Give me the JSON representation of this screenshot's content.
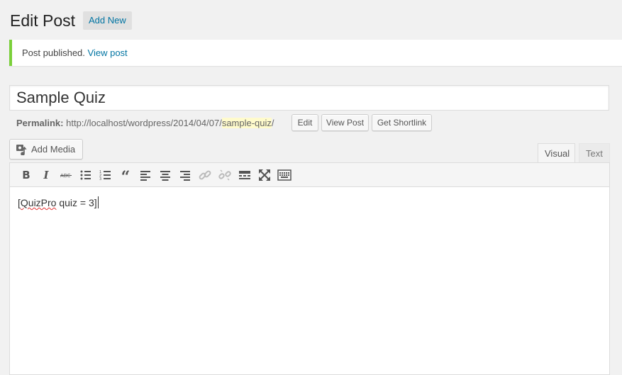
{
  "header": {
    "title": "Edit Post",
    "add_new_label": "Add New"
  },
  "notice": {
    "text": "Post published.",
    "link_label": "View post",
    "accent_color": "#7ad03a"
  },
  "post": {
    "title": "Sample Quiz",
    "permalink_label": "Permalink:",
    "permalink_base": "http://localhost/wordpress/2014/04/07/",
    "permalink_slug": "sample-quiz",
    "permalink_trailing": "/"
  },
  "permalink_buttons": {
    "edit": "Edit",
    "view_post": "View Post",
    "get_shortlink": "Get Shortlink"
  },
  "editor": {
    "add_media_label": "Add Media",
    "tabs": {
      "visual": "Visual",
      "text": "Text"
    },
    "active_tab": "Visual",
    "toolbar_icons": [
      "bold-icon",
      "italic-icon",
      "strikethrough-icon",
      "bulleted-list-icon",
      "numbered-list-icon",
      "blockquote-icon",
      "align-left-icon",
      "align-center-icon",
      "align-right-icon",
      "insert-link-icon",
      "unlink-icon",
      "read-more-icon",
      "fullscreen-icon",
      "toolbar-toggle-icon"
    ],
    "content_word": "QuizPro",
    "content_open": "[",
    "content_rest": " quiz = 3]"
  },
  "colors": {
    "link": "#0074a2",
    "background": "#f1f1f1"
  }
}
